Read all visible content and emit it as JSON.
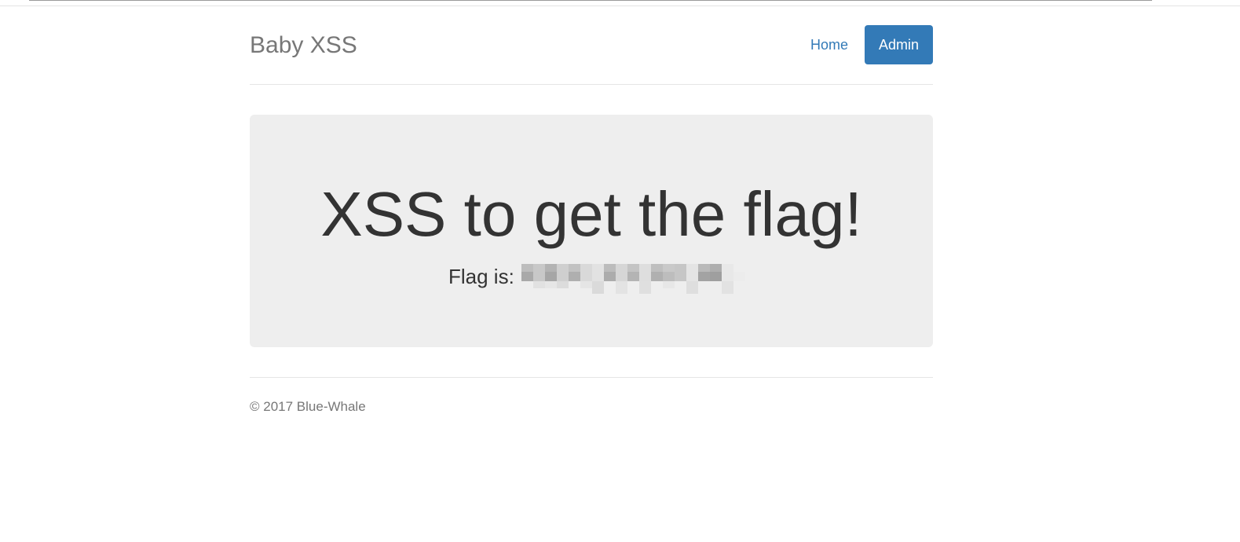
{
  "header": {
    "brand": "Baby XSS",
    "nav": [
      {
        "label": "Home",
        "active": false
      },
      {
        "label": "Admin",
        "active": true
      }
    ]
  },
  "jumbotron": {
    "title": "XSS to get the flag!",
    "flag_label": "Flag is:"
  },
  "footer": {
    "text": "© 2017 Blue-Whale"
  },
  "colors": {
    "accent": "#337ab7",
    "jumbotron_bg": "#eeeeee",
    "muted_text": "#777777"
  }
}
